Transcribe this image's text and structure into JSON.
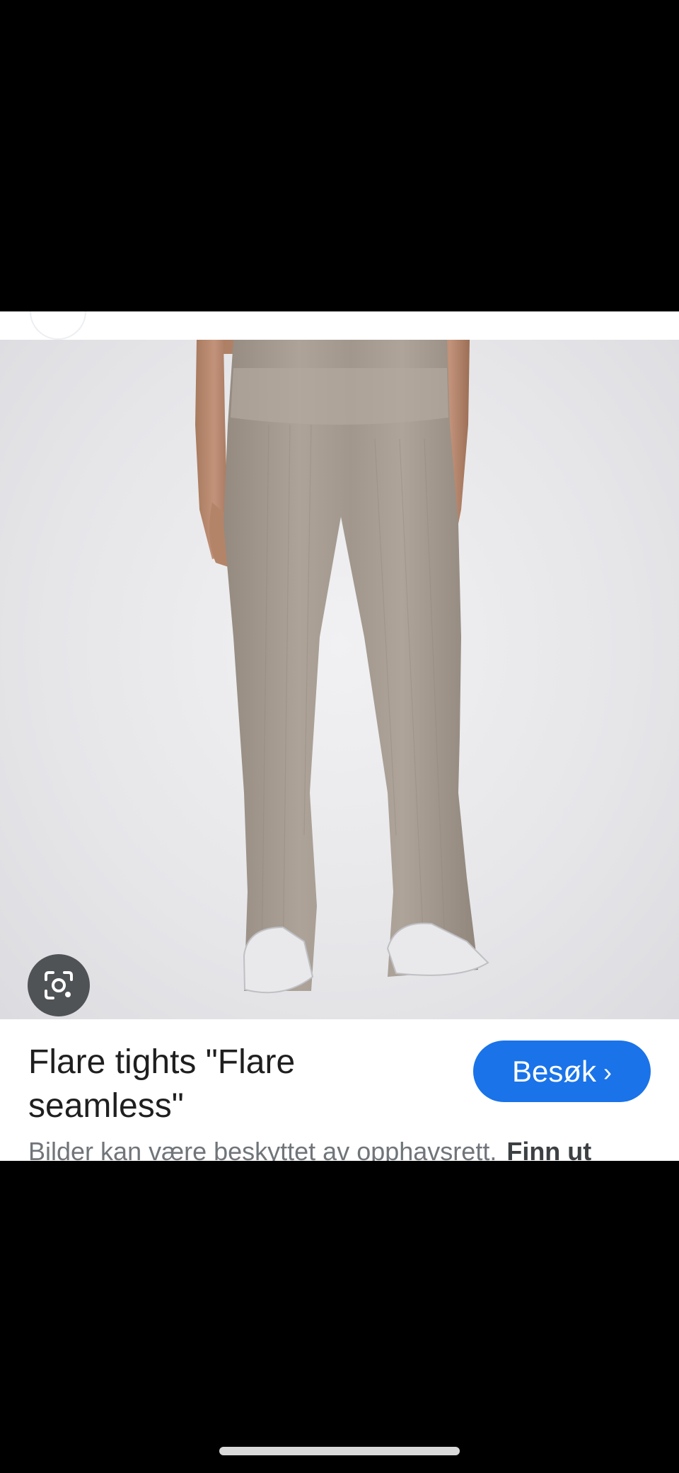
{
  "result": {
    "title": "Flare tights \"Flare seamless\"",
    "visit_label": "Besøk",
    "copyright_notice": "Bilder kan være beskyttet av opphavsrett.",
    "learn_more_label": "Finn ut"
  },
  "icons": {
    "lens": "google-lens-icon",
    "visit_chevron": "chevron-right-icon"
  },
  "colors": {
    "accent": "#1a73e8",
    "lens_button": "#505356",
    "pants": "#a69c92"
  }
}
